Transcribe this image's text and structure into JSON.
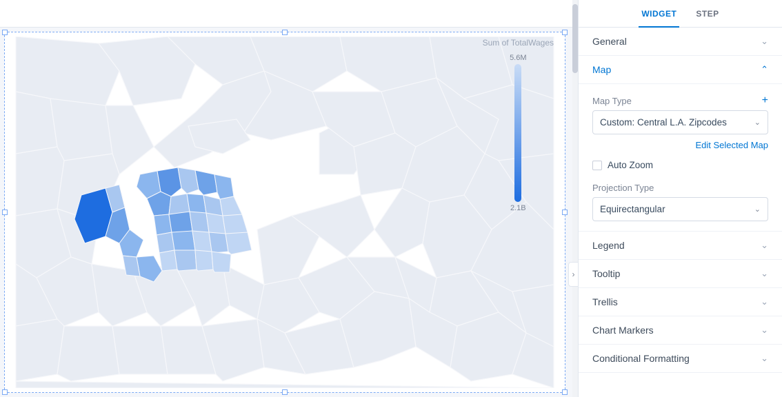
{
  "tabs": {
    "widget": "WIDGET",
    "step": "STEP"
  },
  "sections": {
    "general": "General",
    "map": "Map",
    "legend": "Legend",
    "tooltip": "Tooltip",
    "trellis": "Trellis",
    "chart_markers": "Chart Markers",
    "conditional_formatting": "Conditional Formatting"
  },
  "map_panel": {
    "map_type_label": "Map Type",
    "map_type_value": "Custom: Central L.A. Zipcodes",
    "edit_selected": "Edit Selected Map",
    "auto_zoom_label": "Auto Zoom",
    "auto_zoom_checked": false,
    "projection_type_label": "Projection Type",
    "projection_type_value": "Equirectangular"
  },
  "map_legend": {
    "title": "Sum of TotalWages",
    "max": "5.6M",
    "min": "2.1B"
  }
}
